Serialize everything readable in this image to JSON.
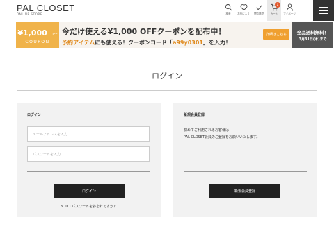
{
  "header": {
    "logo": "PAL CLOSET",
    "logo_sub": "ONLINE STORE",
    "nav": [
      {
        "label": "検索",
        "icon": "search-icon"
      },
      {
        "label": "お気に入り",
        "icon": "heart-icon"
      },
      {
        "label": "閲覧履歴",
        "icon": "checkmark-icon"
      },
      {
        "label": "カート",
        "icon": "cart-icon"
      },
      {
        "label": "マイページ",
        "icon": "person-icon"
      }
    ],
    "cart_count": "1"
  },
  "banner": {
    "coupon_amount": "¥1,000",
    "coupon_off": "OFF",
    "coupon_word": "COUPON",
    "headline": "今だけ使える¥1,000 OFFクーポンを配布中！",
    "sub_prefix": "予約アイテム",
    "sub_middle": "にも使える！クーポンコード「",
    "sub_code": "a99y0301",
    "sub_suffix": "」を入力！",
    "details_label": "詳細はこちら",
    "free_shipping_title": "全品送料無料！",
    "free_shipping_date": "3月31日(木)まで"
  },
  "page": {
    "title": "ログイン"
  },
  "login": {
    "title": "ログイン",
    "email_placeholder": "メールアドレスを入力",
    "password_placeholder": "パスワードを入力",
    "button": "ログイン",
    "forgot": "> ID・パスワードをお忘れですか？"
  },
  "register": {
    "title": "新規会員登録",
    "line1": "初めてご利用されるお客様は",
    "line2": "PAL CLOSET会員のご登録をお願いいたします。",
    "button": "新規会員登録"
  },
  "colors": {
    "accent_orange": "#f0b34a",
    "dark": "#222222",
    "badge": "#e25a2e"
  }
}
